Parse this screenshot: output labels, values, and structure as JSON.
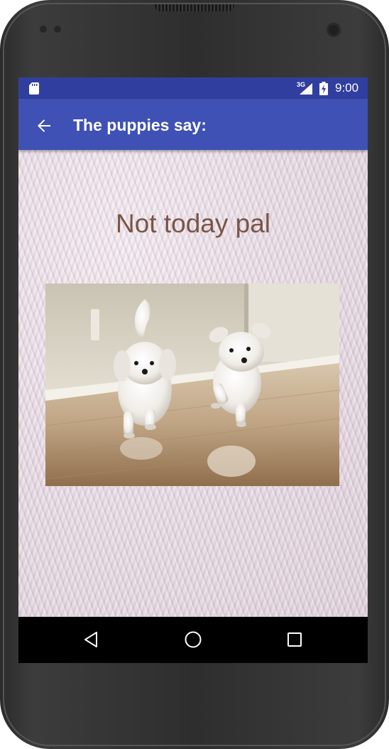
{
  "status_bar": {
    "network": "3G",
    "time": "9:00",
    "icons": [
      "sd-card-icon",
      "signal-icon",
      "battery-icon"
    ]
  },
  "app_bar": {
    "title": "The puppies say:",
    "back_icon": "arrow-back-icon"
  },
  "content": {
    "message": "Not today pal",
    "image": "two-white-puppies-running-photo"
  },
  "nav_bar": {
    "icons": [
      "nav-back-icon",
      "nav-home-icon",
      "nav-recents-icon"
    ]
  },
  "colors": {
    "status_bar": "#303f9f",
    "app_bar": "#3f51b5",
    "message_text": "#795548"
  }
}
